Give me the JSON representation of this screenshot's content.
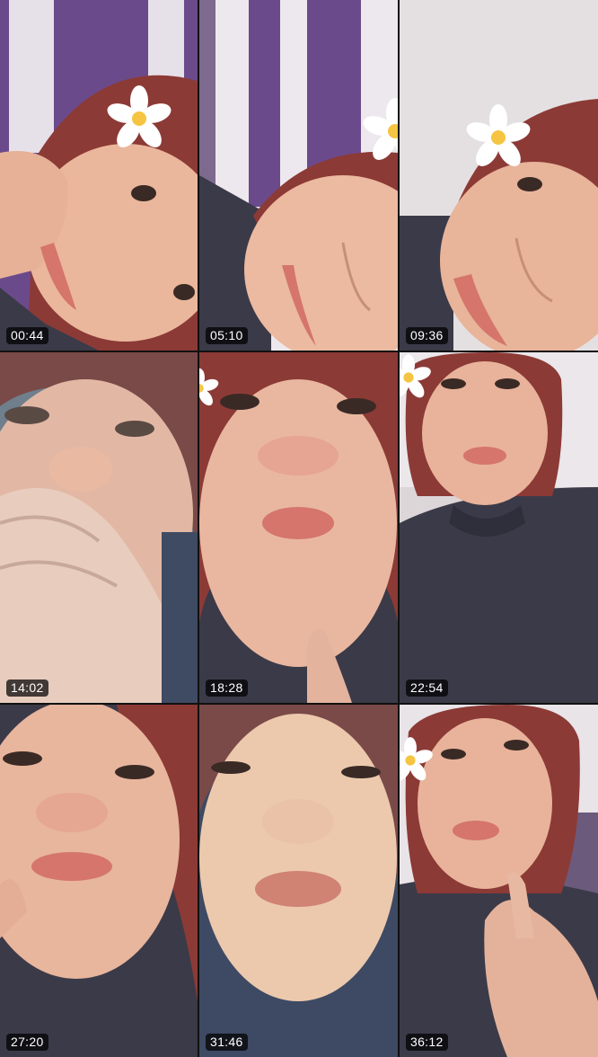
{
  "thumbnails": [
    {
      "timestamp": "00:44"
    },
    {
      "timestamp": "05:10"
    },
    {
      "timestamp": "09:36"
    },
    {
      "timestamp": "14:02"
    },
    {
      "timestamp": "18:28"
    },
    {
      "timestamp": "22:54"
    },
    {
      "timestamp": "27:20"
    },
    {
      "timestamp": "31:46"
    },
    {
      "timestamp": "36:12"
    }
  ],
  "colors": {
    "skin": "#e9b9a0",
    "skin_light": "#f3d2bf",
    "hair": "#8c3a36",
    "shirt": "#3b3a48",
    "wall_purple": "#6b4a8c",
    "wall_light": "#e8e4ea",
    "lips": "#d5756b",
    "flower": "#ffffff",
    "flower_center": "#f5c542"
  }
}
